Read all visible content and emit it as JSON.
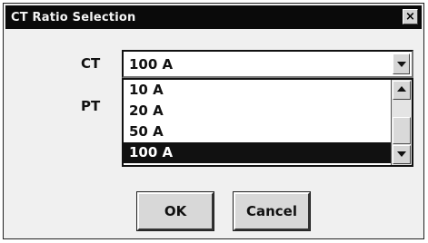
{
  "dialog": {
    "title": "CT Ratio Selection",
    "close_glyph": "×"
  },
  "fields": {
    "ct_label": "CT",
    "pt_label": "PT"
  },
  "ct_combo": {
    "value": "100 A",
    "options": [
      "10 A",
      "20 A",
      "50 A",
      "100 A"
    ],
    "selected_index": 3
  },
  "buttons": {
    "ok": "OK",
    "cancel": "Cancel"
  },
  "icons": [
    "close-icon",
    "chevron-down-icon",
    "scroll-up-icon",
    "scroll-down-icon"
  ]
}
